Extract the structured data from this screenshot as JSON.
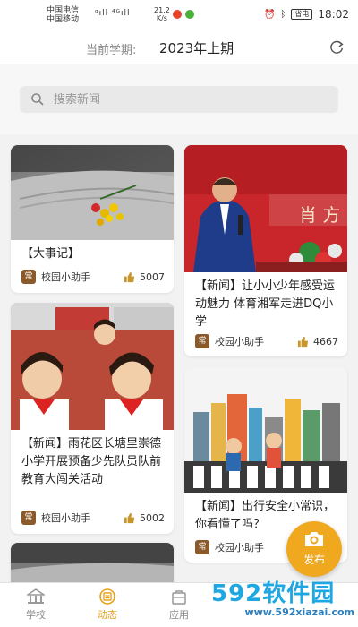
{
  "status_bar": {
    "carrier_1": "中国电信",
    "carrier_2": "中国移动",
    "signal": "ᵍıll ⁴ᴳıll",
    "speed_value": "21.2",
    "speed_unit": "K/s",
    "battery": "省电",
    "time": "18:02"
  },
  "term": {
    "label": "当前学期:",
    "value": "2023年上期"
  },
  "search": {
    "placeholder": "搜索新闻"
  },
  "feed": {
    "cards": [
      {
        "title": "【大事记】",
        "avatar": "常",
        "author": "校园小助手",
        "likes": "5007"
      },
      {
        "banner_text": "肖 方",
        "title": "【新闻】让小小少年感受运动魅力 体育湘军走进DQ小学",
        "avatar": "常",
        "author": "校园小助手",
        "likes": "4667"
      },
      {
        "title": "【新闻】雨花区长塘里崇德小学开展预备少先队员队前教育大闯关活动",
        "avatar": "常",
        "author": "校园小助手",
        "likes": "5002"
      },
      {
        "title": "【新闻】出行安全小常识，你看懂了吗？",
        "avatar": "常",
        "author": "校园小助手",
        "likes": ""
      }
    ]
  },
  "fab": {
    "label": "发布"
  },
  "tabbar": {
    "tabs": [
      {
        "label": "学校"
      },
      {
        "label": "动态"
      },
      {
        "label": "应用"
      }
    ]
  },
  "watermark": {
    "brand": "592软件园",
    "url": "www.592xiazai.com"
  },
  "colors": {
    "accent": "#f0a81f",
    "active_tab": "#e5a21a",
    "watermark": "#1ea7e0"
  }
}
